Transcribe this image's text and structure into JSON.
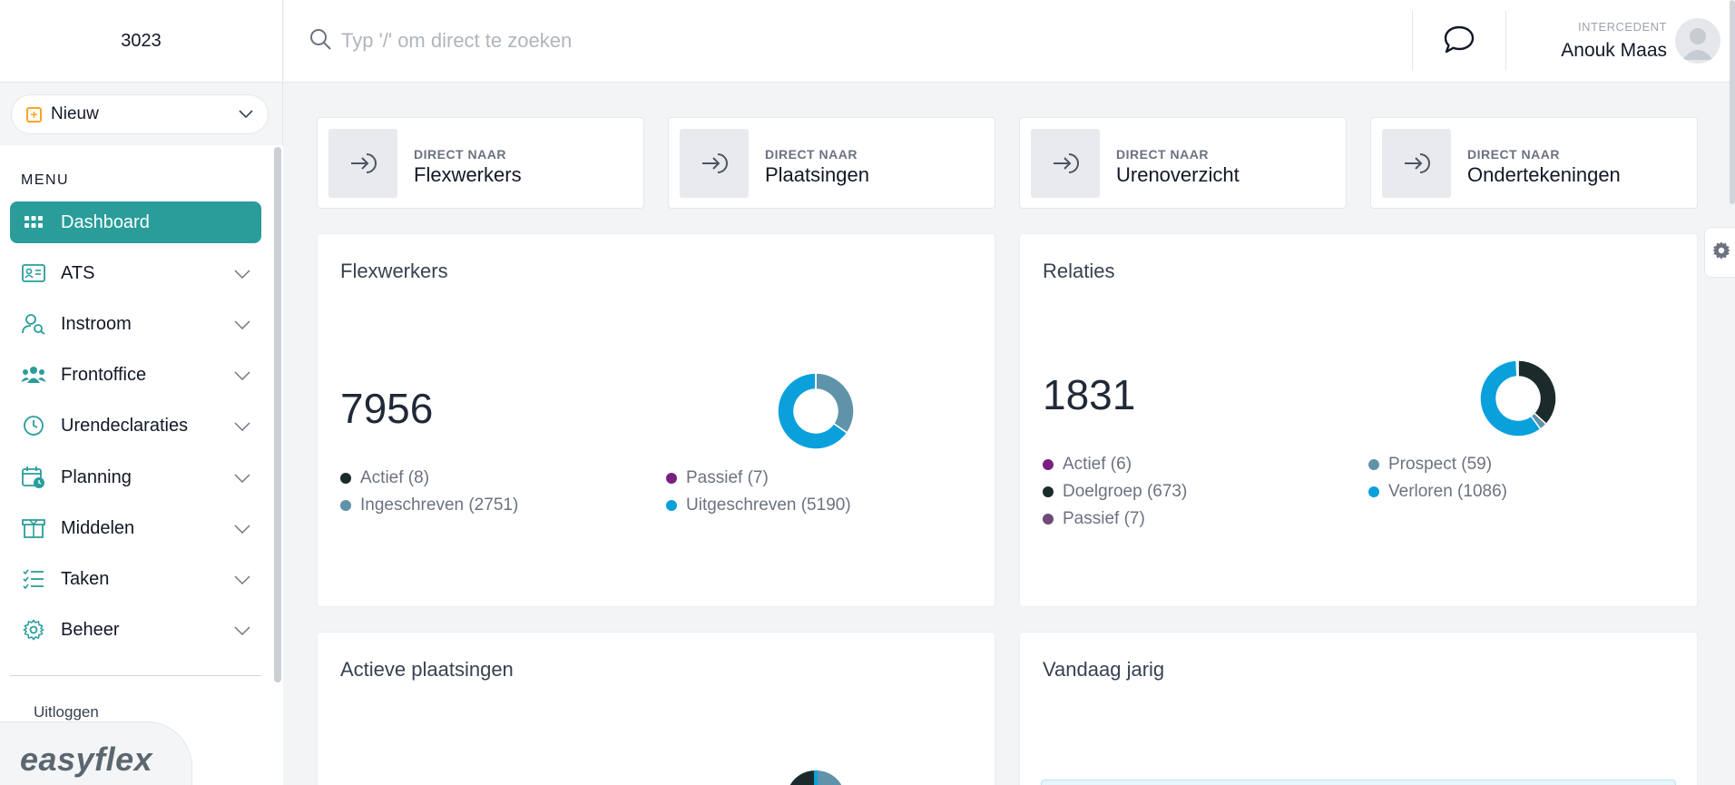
{
  "app": {
    "tenant_code": "3023",
    "logo_text": "easyflex"
  },
  "sidebar": {
    "new_button_label": "Nieuw",
    "menu_title": "MENU",
    "items": [
      {
        "label": "Dashboard",
        "icon": "dashboard-grid-icon",
        "active": true
      },
      {
        "label": "ATS",
        "icon": "id-card-icon"
      },
      {
        "label": "Instroom",
        "icon": "user-search-icon"
      },
      {
        "label": "Frontoffice",
        "icon": "users-group-icon"
      },
      {
        "label": "Urendeclaraties",
        "icon": "clock-icon"
      },
      {
        "label": "Planning",
        "icon": "calendar-clock-icon"
      },
      {
        "label": "Middelen",
        "icon": "box-icon"
      },
      {
        "label": "Taken",
        "icon": "checklist-icon"
      },
      {
        "label": "Beheer",
        "icon": "gear-icon"
      }
    ],
    "logout_label": "Uitloggen"
  },
  "header": {
    "search_placeholder": "Typ '/' om direct te zoeken",
    "user_role": "INTERCEDENT",
    "user_name": "Anouk Maas"
  },
  "quick_links": [
    {
      "small": "DIRECT NAAR",
      "label": "Flexwerkers"
    },
    {
      "small": "DIRECT NAAR",
      "label": "Plaatsingen"
    },
    {
      "small": "DIRECT NAAR",
      "label": "Urenoverzicht"
    },
    {
      "small": "DIRECT NAAR",
      "label": "Ondertekeningen"
    }
  ],
  "panels": {
    "flexwerkers": {
      "title": "Flexwerkers",
      "total": "7956",
      "legend": [
        {
          "label": "Actief (8)",
          "value": 8,
          "color": "#1b2b2b"
        },
        {
          "label": "Passief (7)",
          "value": 7,
          "color": "#7a1f7f"
        },
        {
          "label": "Ingeschreven (2751)",
          "value": 2751,
          "color": "#5f93aa"
        },
        {
          "label": "Uitgeschreven (5190)",
          "value": 5190,
          "color": "#0aa0dc"
        }
      ]
    },
    "relaties": {
      "title": "Relaties",
      "total": "1831",
      "legend": [
        {
          "label": "Actief (6)",
          "value": 6,
          "color": "#7a1f7f"
        },
        {
          "label": "Prospect (59)",
          "value": 59,
          "color": "#5f93aa"
        },
        {
          "label": "Doelgroep (673)",
          "value": 673,
          "color": "#1b2b2b"
        },
        {
          "label": "Verloren (1086)",
          "value": 1086,
          "color": "#0aa0dc"
        },
        {
          "label": "Passief (7)",
          "value": 7,
          "color": "#6d4a7a"
        }
      ]
    },
    "actieve_plaatsingen": {
      "title": "Actieve plaatsingen"
    },
    "vandaag_jarig": {
      "title": "Vandaag jarig"
    }
  }
}
